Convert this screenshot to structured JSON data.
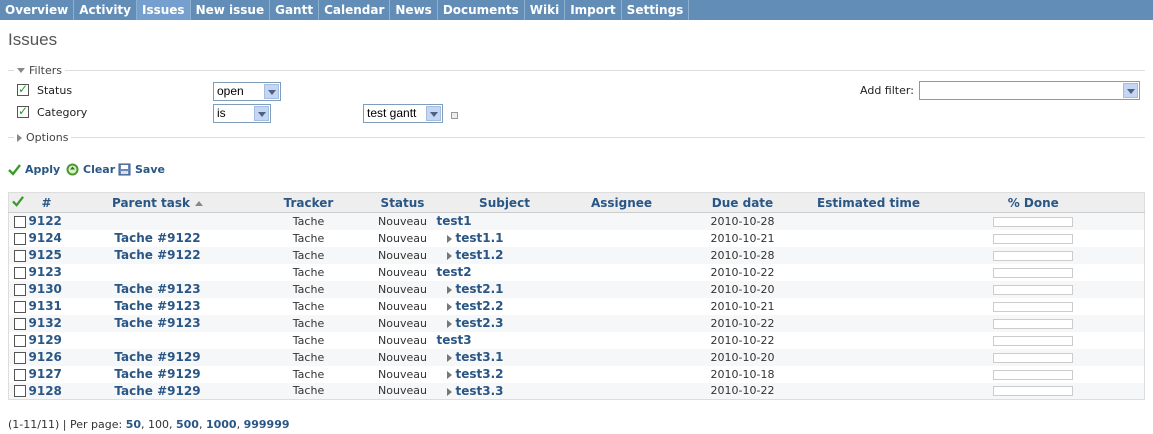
{
  "menu": [
    {
      "label": "Overview",
      "selected": false
    },
    {
      "label": "Activity",
      "selected": false
    },
    {
      "label": "Issues",
      "selected": true
    },
    {
      "label": "New issue",
      "selected": false
    },
    {
      "label": "Gantt",
      "selected": false
    },
    {
      "label": "Calendar",
      "selected": false
    },
    {
      "label": "News",
      "selected": false
    },
    {
      "label": "Documents",
      "selected": false
    },
    {
      "label": "Wiki",
      "selected": false
    },
    {
      "label": "Import",
      "selected": false
    },
    {
      "label": "Settings",
      "selected": false
    }
  ],
  "page_title": "Issues",
  "filters": {
    "legend": "Filters",
    "status": {
      "label": "Status",
      "operator": "open"
    },
    "category": {
      "label": "Category",
      "operator": "is",
      "value": "test gantt"
    },
    "add_filter_label": "Add filter:",
    "add_filter_value": ""
  },
  "options_legend": "Options",
  "actions": {
    "apply": "Apply",
    "clear": "Clear",
    "save": "Save"
  },
  "table": {
    "headers": {
      "id": "#",
      "parent": "Parent task",
      "tracker": "Tracker",
      "status": "Status",
      "subject": "Subject",
      "assignee": "Assignee",
      "due": "Due date",
      "estimated": "Estimated time",
      "done": "% Done"
    },
    "rows": [
      {
        "id": "9122",
        "parent": "",
        "tracker": "Tache",
        "status": "Nouveau",
        "subject": "test1",
        "child": false,
        "due": "2010-10-28",
        "done": 0
      },
      {
        "id": "9124",
        "parent": "Tache #9122",
        "tracker": "Tache",
        "status": "Nouveau",
        "subject": "test1.1",
        "child": true,
        "due": "2010-10-21",
        "done": 0
      },
      {
        "id": "9125",
        "parent": "Tache #9122",
        "tracker": "Tache",
        "status": "Nouveau",
        "subject": "test1.2",
        "child": true,
        "due": "2010-10-28",
        "done": 0
      },
      {
        "id": "9123",
        "parent": "",
        "tracker": "Tache",
        "status": "Nouveau",
        "subject": "test2",
        "child": false,
        "due": "2010-10-22",
        "done": 0
      },
      {
        "id": "9130",
        "parent": "Tache #9123",
        "tracker": "Tache",
        "status": "Nouveau",
        "subject": "test2.1",
        "child": true,
        "due": "2010-10-20",
        "done": 0
      },
      {
        "id": "9131",
        "parent": "Tache #9123",
        "tracker": "Tache",
        "status": "Nouveau",
        "subject": "test2.2",
        "child": true,
        "due": "2010-10-21",
        "done": 0
      },
      {
        "id": "9132",
        "parent": "Tache #9123",
        "tracker": "Tache",
        "status": "Nouveau",
        "subject": "test2.3",
        "child": true,
        "due": "2010-10-22",
        "done": 0
      },
      {
        "id": "9129",
        "parent": "",
        "tracker": "Tache",
        "status": "Nouveau",
        "subject": "test3",
        "child": false,
        "due": "2010-10-22",
        "done": 0
      },
      {
        "id": "9126",
        "parent": "Tache #9129",
        "tracker": "Tache",
        "status": "Nouveau",
        "subject": "test3.1",
        "child": true,
        "due": "2010-10-20",
        "done": 0
      },
      {
        "id": "9127",
        "parent": "Tache #9129",
        "tracker": "Tache",
        "status": "Nouveau",
        "subject": "test3.2",
        "child": true,
        "due": "2010-10-18",
        "done": 0
      },
      {
        "id": "9128",
        "parent": "Tache #9129",
        "tracker": "Tache",
        "status": "Nouveau",
        "subject": "test3.3",
        "child": true,
        "due": "2010-10-22",
        "done": 0
      }
    ]
  },
  "pagination": {
    "range": "(1-11/11)",
    "per_page_label": "| Per page:",
    "options": [
      {
        "label": "50",
        "link": true
      },
      {
        "label": "100",
        "link": false
      },
      {
        "label": "500",
        "link": true
      },
      {
        "label": "1000",
        "link": true
      },
      {
        "label": "999999",
        "link": true
      }
    ]
  },
  "colors": {
    "menu_bg": "#628db6",
    "menu_selected": "#759fcf",
    "link": "#2a5685"
  }
}
